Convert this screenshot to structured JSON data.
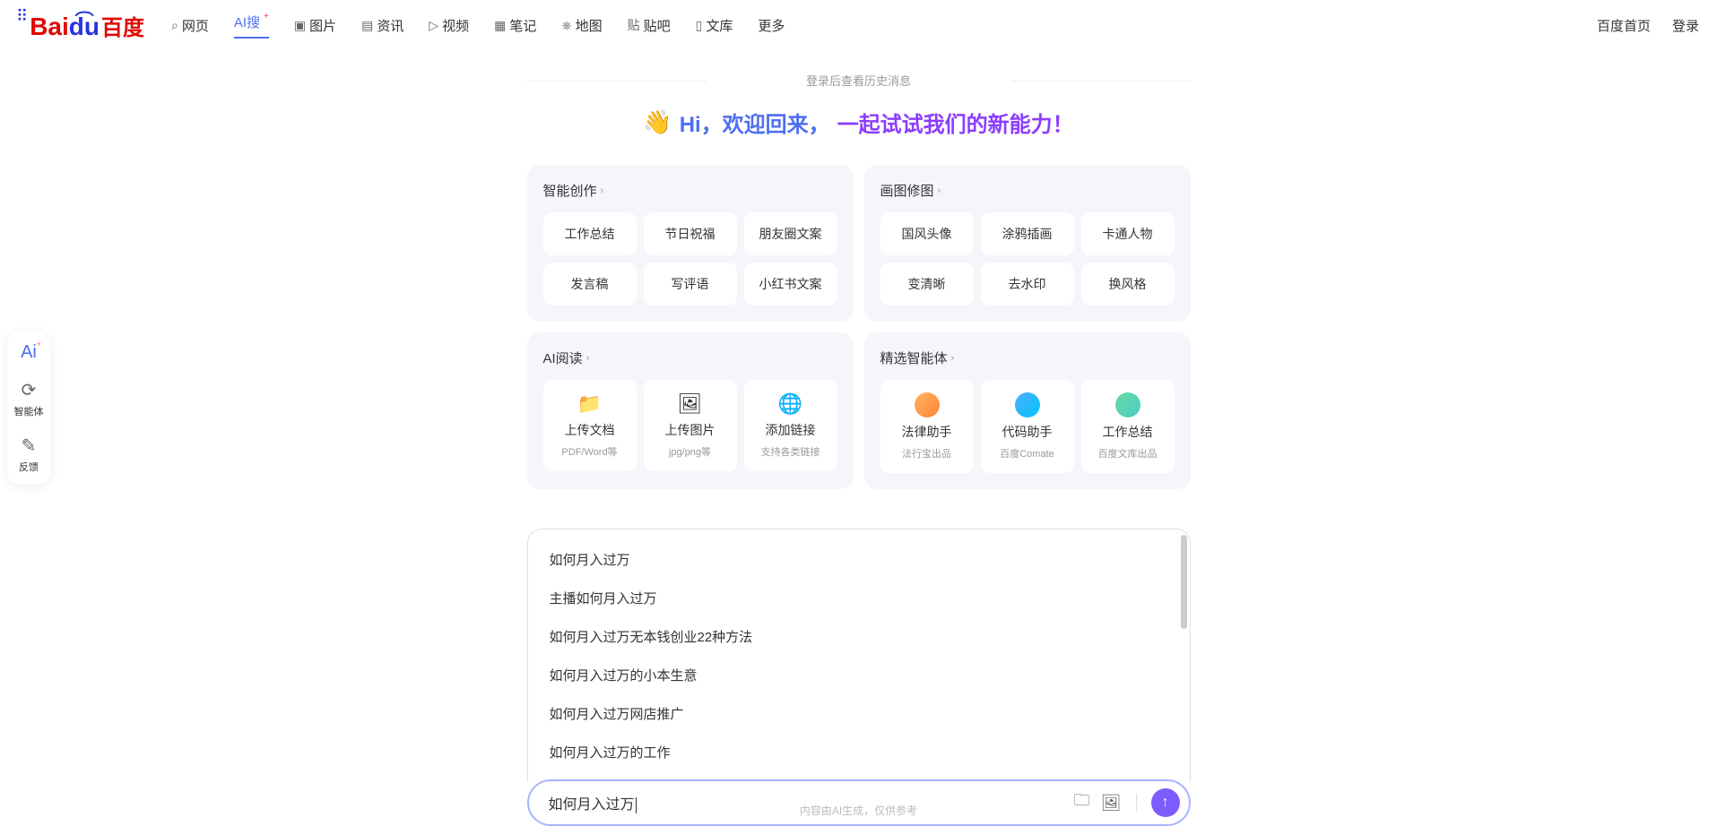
{
  "header": {
    "nav": [
      "网页",
      "AI搜",
      "图片",
      "资讯",
      "视频",
      "笔记",
      "地图",
      "贴吧",
      "文库",
      "更多"
    ],
    "right": [
      "百度首页",
      "登录"
    ]
  },
  "sidebar": [
    {
      "label": "",
      "icon": "Ai"
    },
    {
      "label": "智能体",
      "icon": "⟳"
    },
    {
      "label": "反馈",
      "icon": "✎"
    }
  ],
  "main": {
    "history_hint": "登录后查看历史消息",
    "greeting_1": "Hi，欢迎回来，",
    "greeting_2": "一起试试我们的新能力！",
    "creation": {
      "title": "智能创作",
      "chips": [
        "工作总结",
        "节日祝福",
        "朋友圈文案",
        "发言稿",
        "写评语",
        "小红书文案"
      ]
    },
    "image_edit": {
      "title": "画图修图",
      "chips": [
        "国风头像",
        "涂鸦插画",
        "卡通人物",
        "变清晰",
        "去水印",
        "换风格"
      ]
    },
    "reading": {
      "title": "AI阅读",
      "items": [
        {
          "icon": "📁",
          "title": "上传文档",
          "sub": "PDF/Word等"
        },
        {
          "icon": "🖼",
          "title": "上传图片",
          "sub": "jpg/png等"
        },
        {
          "icon": "🌐",
          "title": "添加链接",
          "sub": "支持各类链接"
        }
      ]
    },
    "agents": {
      "title": "精选智能体",
      "items": [
        {
          "title": "法律助手",
          "sub": "法行宝出品"
        },
        {
          "title": "代码助手",
          "sub": "百度Comate"
        },
        {
          "title": "工作总结",
          "sub": "百度文库出品"
        }
      ]
    }
  },
  "suggestions": [
    "如何月入过万",
    "主播如何月入过万",
    "如何月入过万无本钱创业22种方法",
    "如何月入过万的小本生意",
    "如何月入过万网店推广",
    "如何月入过万的工作"
  ],
  "input": {
    "value": "如何月入过万"
  },
  "footer": "内容由AI生成，仅供参考"
}
